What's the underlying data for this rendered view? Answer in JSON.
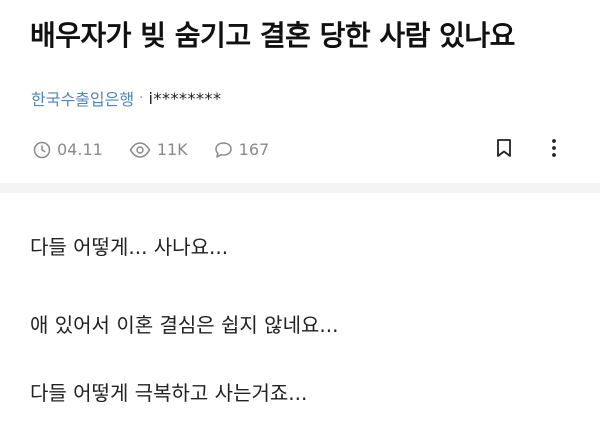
{
  "post": {
    "title": "배우자가 빚 숨기고 결혼 당한 사람 있나요",
    "company": "한국수출입은행",
    "separator": "·",
    "author": "i********",
    "date": "04.11",
    "views": "11K",
    "comments": "167"
  },
  "icons": {
    "date": "clock-icon",
    "views": "eye-icon",
    "comments": "comment-icon",
    "bookmark": "bookmark-icon",
    "more": "more-vertical-icon"
  },
  "body": {
    "lines": [
      "다들 어떻게... 사나요...",
      "애 있어서 이혼 결심은 쉽지 않네요...",
      "다들 어떻게 극복하고 사는거죠..."
    ]
  },
  "colors": {
    "company_link": "#4f86b6",
    "meta_gray": "#8a8a8a",
    "divider": "#f4f4f5"
  }
}
